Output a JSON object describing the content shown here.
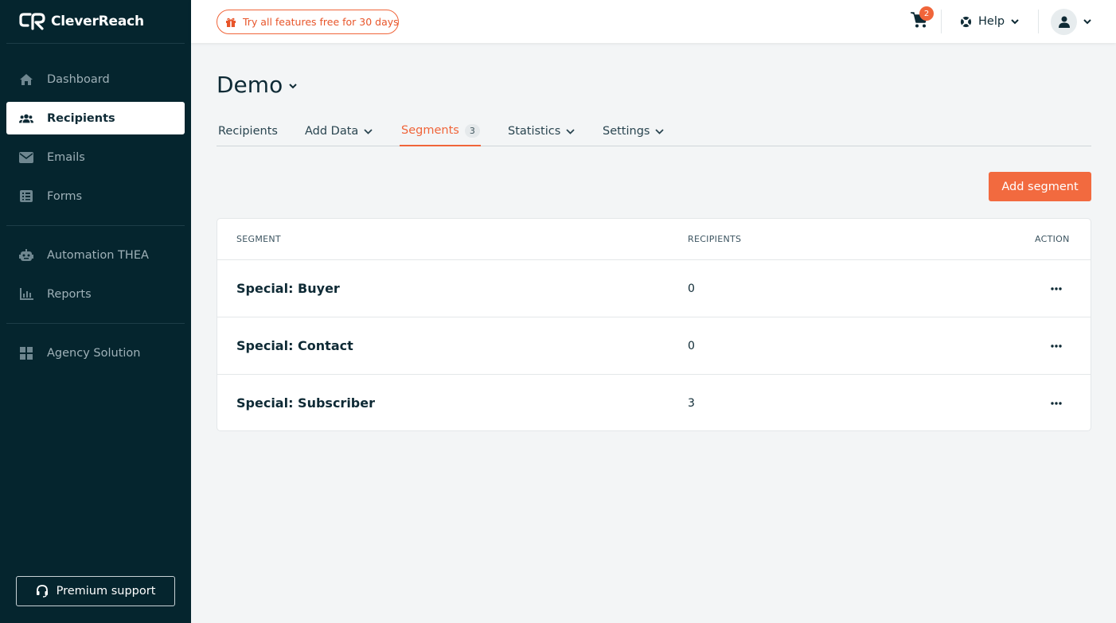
{
  "app": {
    "brand": "CleverReach"
  },
  "sidebar": {
    "items": [
      {
        "label": "Dashboard",
        "icon": "home-icon"
      },
      {
        "label": "Recipients",
        "icon": "users-icon",
        "active": true
      },
      {
        "label": "Emails",
        "icon": "envelope-icon"
      },
      {
        "label": "Forms",
        "icon": "form-icon"
      },
      {
        "label": "Automation THEA",
        "icon": "robot-icon"
      },
      {
        "label": "Reports",
        "icon": "bar-chart-icon"
      },
      {
        "label": "Agency Solution",
        "icon": "grid-icon"
      }
    ],
    "premium_support_label": "Premium support"
  },
  "topbar": {
    "trial_label": "Try all features free for 30 days",
    "cart_count": "2",
    "help_label": "Help"
  },
  "page": {
    "title": "Demo",
    "tabs": [
      {
        "label": "Recipients"
      },
      {
        "label": "Add Data",
        "dropdown": true
      },
      {
        "label": "Segments",
        "count": "3",
        "active": true
      },
      {
        "label": "Statistics",
        "dropdown": true
      },
      {
        "label": "Settings",
        "dropdown": true
      }
    ],
    "add_segment_label": "Add segment"
  },
  "table": {
    "headers": {
      "segment": "SEGMENT",
      "recipients": "RECIPIENTS",
      "action": "ACTION"
    },
    "rows": [
      {
        "name": "Special: Buyer",
        "recipients": "0"
      },
      {
        "name": "Special: Contact",
        "recipients": "0"
      },
      {
        "name": "Special: Subscriber",
        "recipients": "3"
      }
    ]
  },
  "colors": {
    "sidebar_bg": "#05252e",
    "accent": "#f26a3f",
    "text_dark": "#0e2a35"
  }
}
